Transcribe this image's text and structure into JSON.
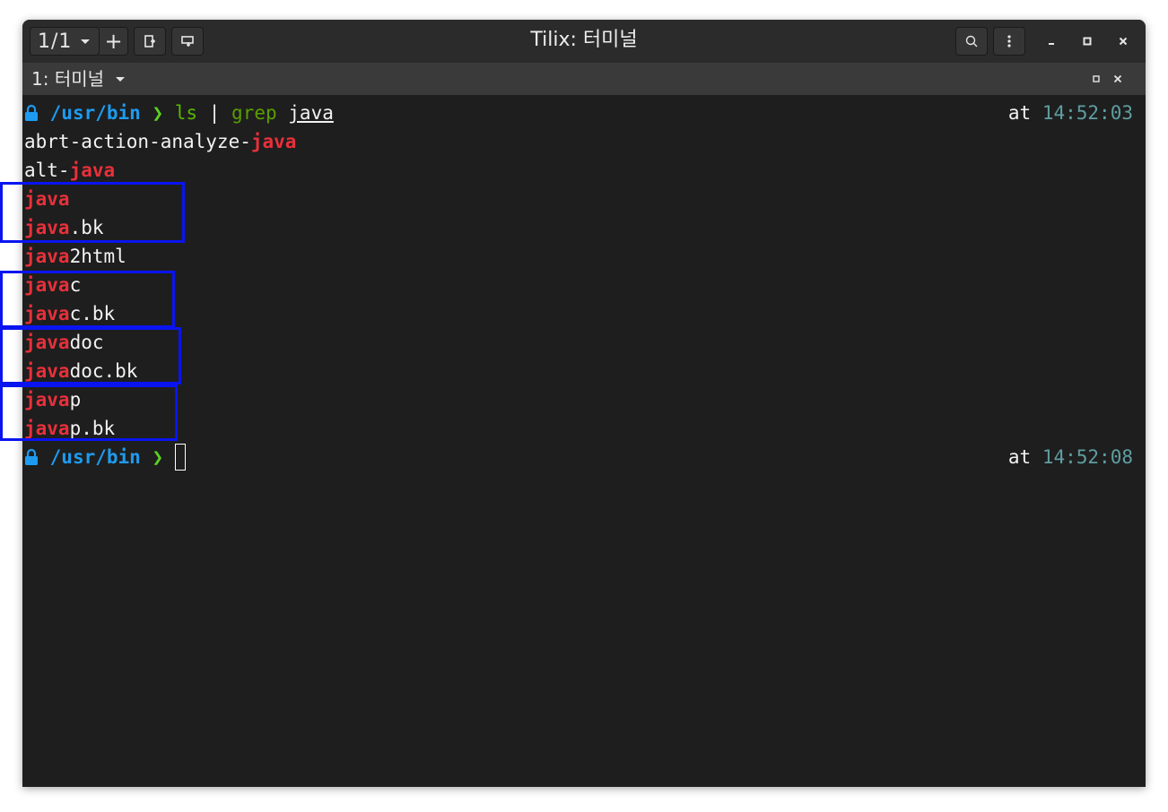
{
  "titlebar": {
    "session_label": "1/1",
    "add_label": "+",
    "title": "Tilix: 터미널"
  },
  "subbar": {
    "terminal_title": "1: 터미널"
  },
  "terminal": {
    "prompt1": {
      "path": "/usr/bin",
      "arrow": "❯",
      "cmd_ls": "ls",
      "cmd_pipe": "|",
      "cmd_grep": "grep",
      "cmd_arg": "java",
      "at": "at",
      "time": "14:52:03"
    },
    "output": [
      {
        "pre": "abrt-action-analyze-",
        "match": "java",
        "post": ""
      },
      {
        "pre": "alt-",
        "match": "java",
        "post": ""
      },
      {
        "pre": "",
        "match": "java",
        "post": ""
      },
      {
        "pre": "",
        "match": "java",
        "post": ".bk"
      },
      {
        "pre": "",
        "match": "java",
        "post": "2html"
      },
      {
        "pre": "",
        "match": "java",
        "post": "c"
      },
      {
        "pre": "",
        "match": "java",
        "post": "c.bk"
      },
      {
        "pre": "",
        "match": "java",
        "post": "doc"
      },
      {
        "pre": "",
        "match": "java",
        "post": "doc.bk"
      },
      {
        "pre": "",
        "match": "java",
        "post": "p"
      },
      {
        "pre": "",
        "match": "java",
        "post": "p.bk"
      }
    ],
    "prompt2": {
      "path": "/usr/bin",
      "arrow": "❯",
      "at": "at",
      "time": "14:52:08"
    }
  },
  "colors": {
    "match": "#e8303a",
    "path": "#1d9bf0",
    "arrow": "#5bd024",
    "time": "#5f9ea0",
    "highlight": "#0a14f0"
  }
}
